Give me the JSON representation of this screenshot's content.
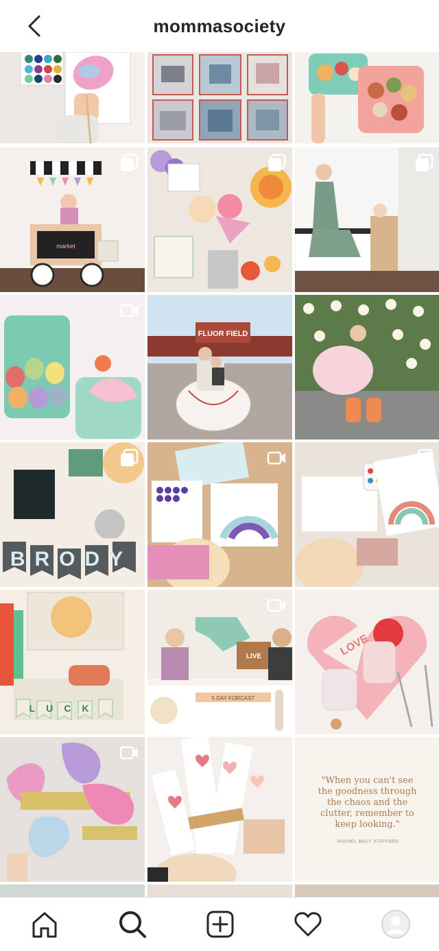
{
  "header": {
    "username": "mommasociety"
  },
  "grid": {
    "post_types": [
      "image",
      "image",
      "image",
      "carousel",
      "carousel",
      "carousel",
      "video",
      "image",
      "image",
      "carousel",
      "video",
      "carousel",
      "image",
      "video",
      "image",
      "video",
      "image",
      "quote"
    ],
    "quote": {
      "text": "\"When you can't see the goodness through the chaos and the clutter, remember to keep looking.\"",
      "author": "-RACHEL MACY STAFFORD"
    },
    "photo_text": {
      "market_sign": "market",
      "birthday_banner": "BRODY",
      "luck_banner": "LUCK",
      "love_pennant": "LOVE",
      "live_box": "LIVE",
      "forecast_label": "5 DAY FORCAST",
      "stadium_sign": "FLUOR FIELD"
    }
  },
  "colors": {
    "text_primary": "#262626",
    "divider": "#dbdbdb",
    "quote_text": "#b07a52"
  },
  "nav": {
    "items": [
      "home-icon",
      "search-icon",
      "new-post-icon",
      "activity-heart-icon",
      "profile-avatar"
    ],
    "active": "search-icon"
  }
}
